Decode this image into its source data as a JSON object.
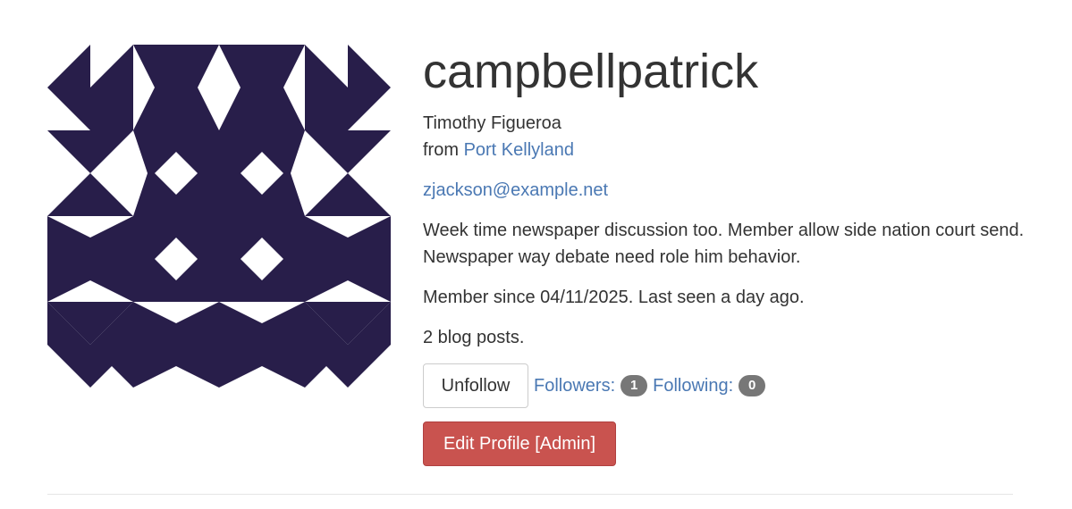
{
  "profile": {
    "username": "campbellpatrick",
    "full_name": "Timothy Figueroa",
    "from_prefix": "from ",
    "location": "Port Kellyland",
    "email": "zjackson@example.net",
    "about": "Week time newspaper discussion too. Member allow side nation court send. Newspaper way debate need role him behavior.",
    "member_since": "Member since 04/11/2025. Last seen a day ago.",
    "blog_posts": "2 blog posts.",
    "avatar_color": "#281e4a"
  },
  "actions": {
    "unfollow_label": "Unfollow",
    "followers_label": "Followers:",
    "followers_count": "1",
    "following_label": "Following:",
    "following_count": "0",
    "edit_label": "Edit Profile [Admin]"
  }
}
